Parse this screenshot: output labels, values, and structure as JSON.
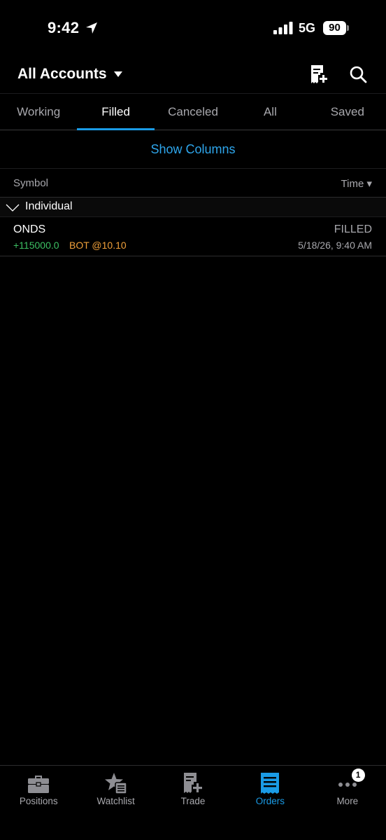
{
  "status_bar": {
    "time": "9:42",
    "network": "5G",
    "battery": "90"
  },
  "header": {
    "account_title": "All Accounts"
  },
  "tabs": [
    {
      "label": "Working"
    },
    {
      "label": "Filled"
    },
    {
      "label": "Canceled"
    },
    {
      "label": "All"
    },
    {
      "label": "Saved"
    }
  ],
  "active_tab": "Filled",
  "show_columns_label": "Show Columns",
  "columns": {
    "symbol": "Symbol",
    "time": "Time ▾"
  },
  "group": {
    "label": "Individual"
  },
  "orders": [
    {
      "symbol": "ONDS",
      "status": "FILLED",
      "quantity": "+115000.0",
      "action": "BOT @10.10",
      "time": "5/18/26, 9:40 AM"
    }
  ],
  "bottom_nav": [
    {
      "label": "Positions",
      "icon": "briefcase-icon"
    },
    {
      "label": "Watchlist",
      "icon": "star-list-icon"
    },
    {
      "label": "Trade",
      "icon": "trade-icon"
    },
    {
      "label": "Orders",
      "icon": "orders-icon"
    },
    {
      "label": "More",
      "icon": "more-icon",
      "badge": "1"
    }
  ],
  "colors": {
    "accent": "#1a9be6",
    "positive": "#3cc063",
    "action": "#f0a03a",
    "muted": "#a8a8ad"
  }
}
